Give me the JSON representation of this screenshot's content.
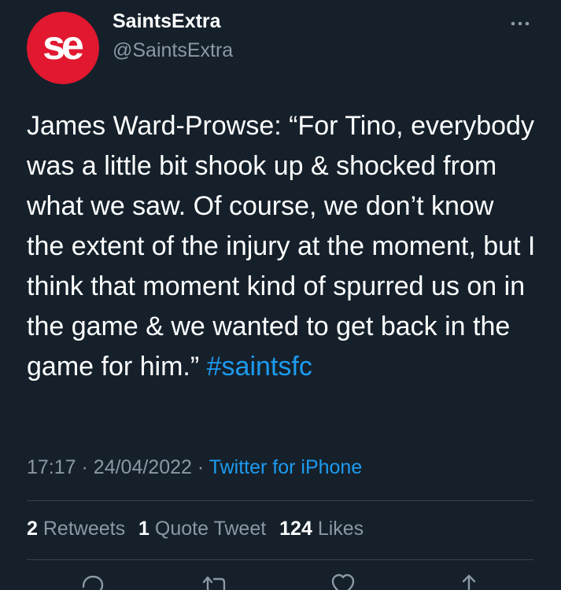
{
  "account": {
    "avatar_text": "se",
    "display_name": "SaintsExtra",
    "handle": "@SaintsExtra"
  },
  "tweet": {
    "text": "James Ward-Prowse: “For Tino, everybody was a little bit shook up & shocked from what we saw. Of course, we don’t know the extent of the injury at the moment, but I think that moment kind of spurred us on in the game & we wanted to get back in the game for him.”",
    "hashtag": "#saintsfc"
  },
  "meta": {
    "time": "17:17",
    "separator": "·",
    "date": "24/04/2022",
    "source": "Twitter for iPhone"
  },
  "stats": {
    "retweets_count": "2",
    "retweets_label": "Retweets",
    "quotes_count": "1",
    "quotes_label": "Quote Tweet",
    "likes_count": "124",
    "likes_label": "Likes"
  },
  "icons": {
    "more": "more-horizontal-icon",
    "reply": "reply-icon",
    "retweet": "retweet-icon",
    "like": "heart-icon",
    "share": "share-icon"
  },
  "colors": {
    "background": "#15202b",
    "accent": "#1d9bf0",
    "muted": "#8b98a5",
    "avatar": "#e1182f",
    "divider": "#38444d"
  }
}
